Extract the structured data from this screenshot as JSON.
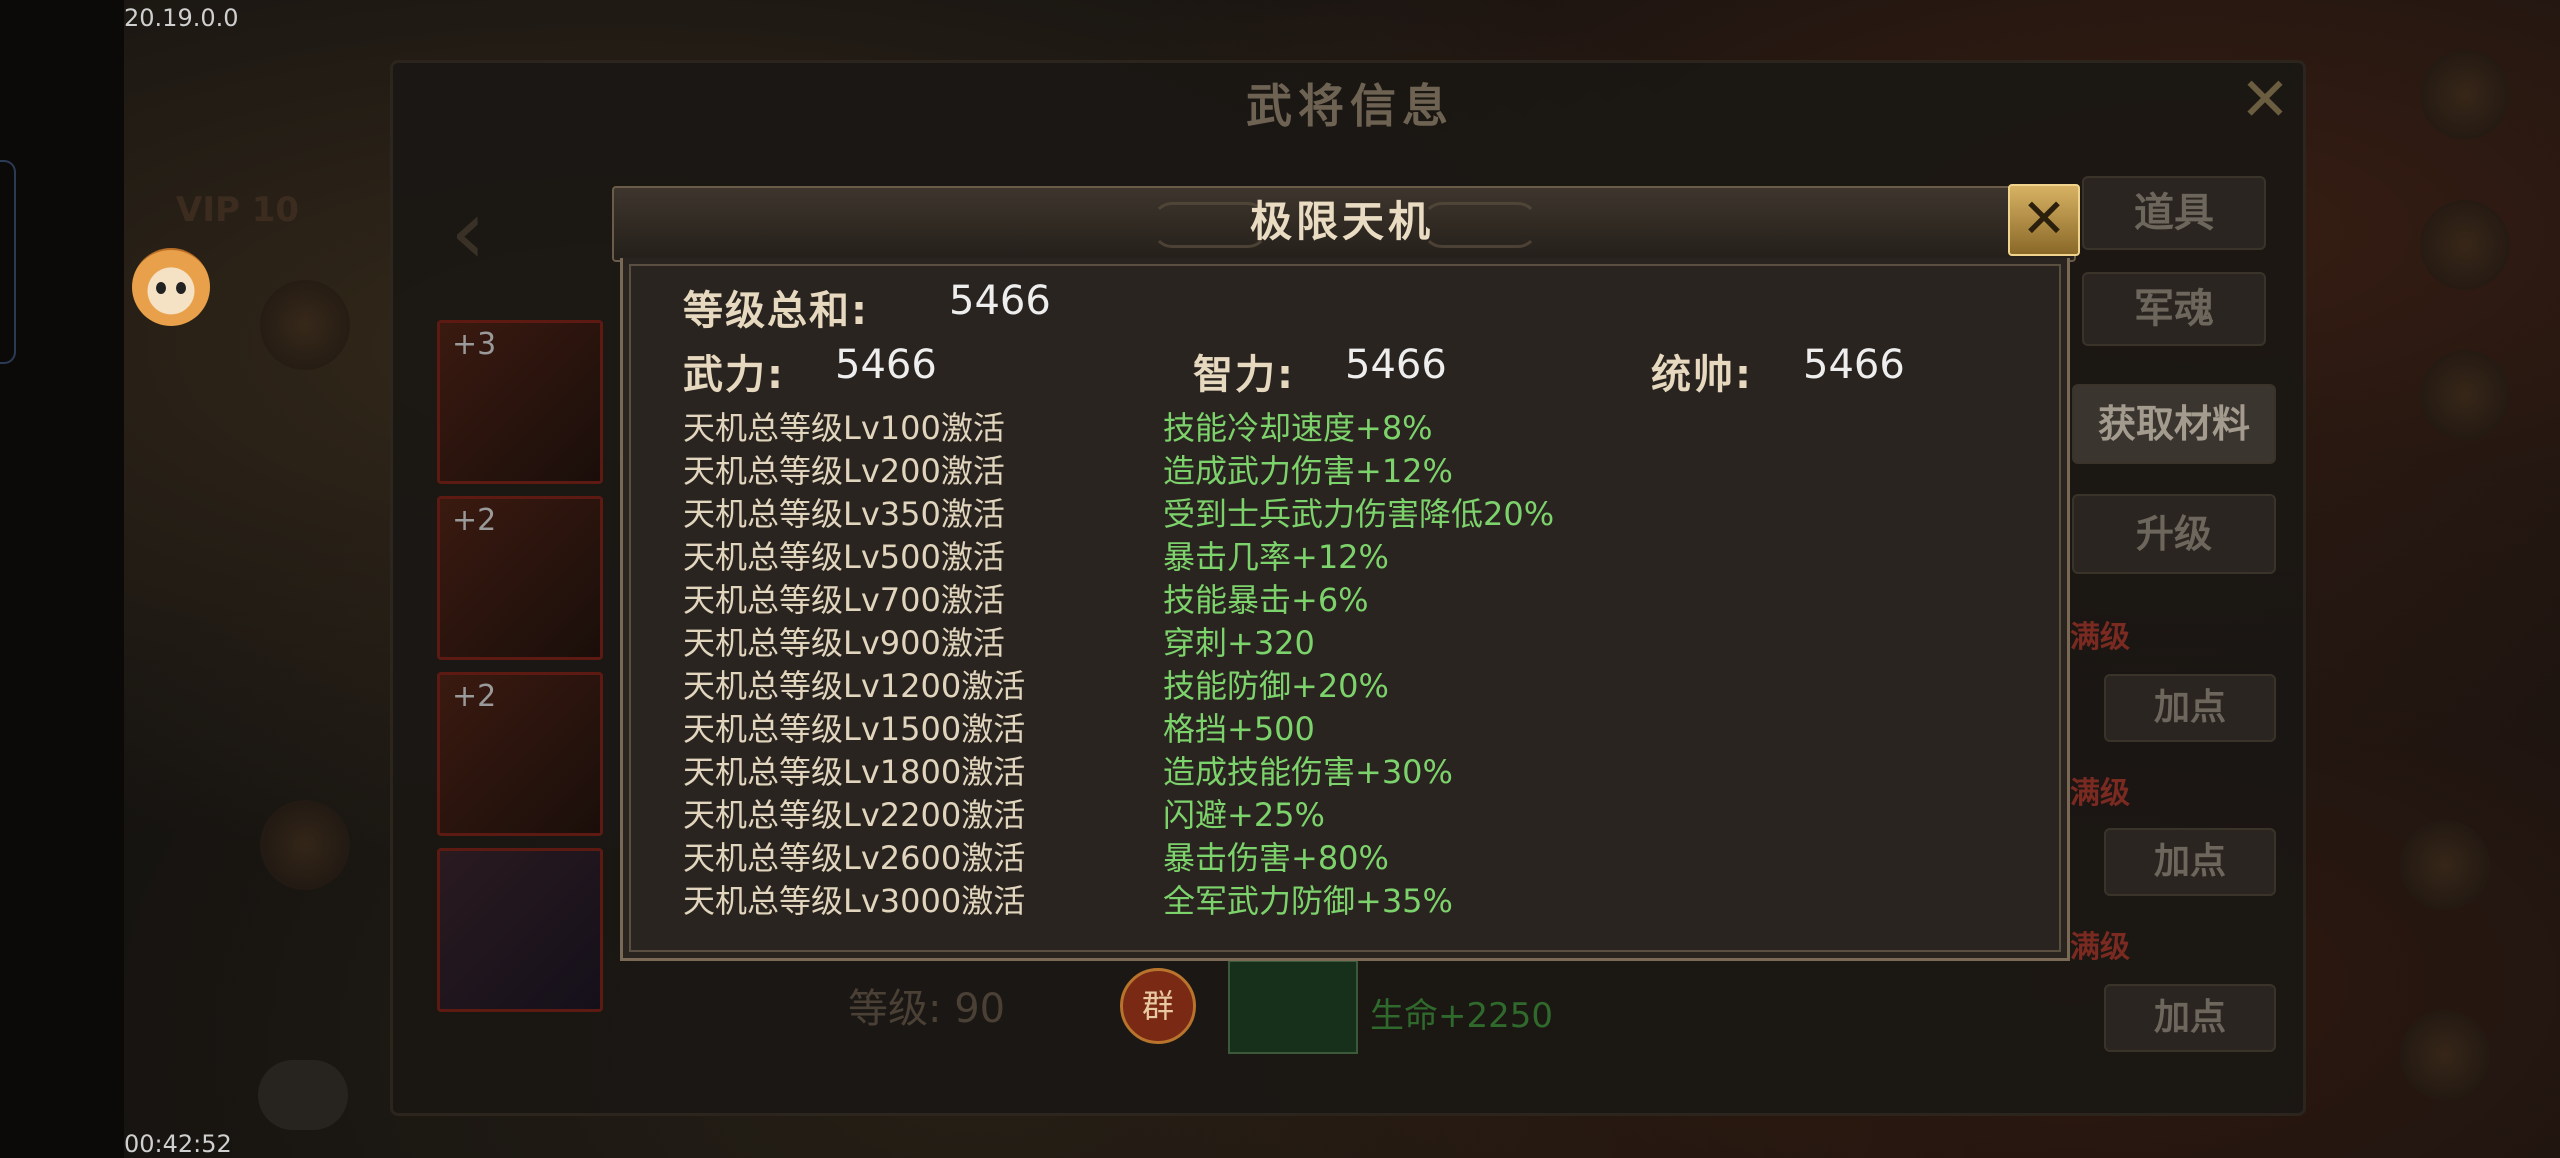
{
  "status": {
    "version": "20.19.0.0",
    "time": "00:42:52"
  },
  "background": {
    "window_title": "武将信息",
    "vip": "VIP 10",
    "buttons": [
      "道具",
      "军魂",
      "获取材料",
      "升级",
      "加点",
      "加点",
      "加点"
    ],
    "max_label": "满级",
    "level_text": "等级: 90",
    "group_badge": "群",
    "life_text": "生命+2250",
    "thumbs": [
      {
        "plus": "+3"
      },
      {
        "plus": "+2"
      },
      {
        "plus": "+2"
      },
      {
        "plus": ""
      }
    ]
  },
  "modal": {
    "title": "极限天机",
    "total_label": "等级总和:",
    "total_value": "5466",
    "stats": [
      {
        "label": "武力:",
        "value": "5466"
      },
      {
        "label": "智力:",
        "value": "5466"
      },
      {
        "label": "统帅:",
        "value": "5466"
      }
    ],
    "rows": [
      {
        "req": "天机总等级Lv100激活",
        "bonus": "技能冷却速度+8%"
      },
      {
        "req": "天机总等级Lv200激活",
        "bonus": "造成武力伤害+12%"
      },
      {
        "req": "天机总等级Lv350激活",
        "bonus": "受到士兵武力伤害降低20%"
      },
      {
        "req": "天机总等级Lv500激活",
        "bonus": "暴击几率+12%"
      },
      {
        "req": "天机总等级Lv700激活",
        "bonus": "技能暴击+6%"
      },
      {
        "req": "天机总等级Lv900激活",
        "bonus": "穿刺+320"
      },
      {
        "req": "天机总等级Lv1200激活",
        "bonus": "技能防御+20%"
      },
      {
        "req": "天机总等级Lv1500激活",
        "bonus": "格挡+500"
      },
      {
        "req": "天机总等级Lv1800激活",
        "bonus": "造成技能伤害+30%"
      },
      {
        "req": "天机总等级Lv2200激活",
        "bonus": "闪避+25%"
      },
      {
        "req": "天机总等级Lv2600激活",
        "bonus": "暴击伤害+80%"
      },
      {
        "req": "天机总等级Lv3000激活",
        "bonus": "全军武力防御+35%"
      }
    ]
  }
}
